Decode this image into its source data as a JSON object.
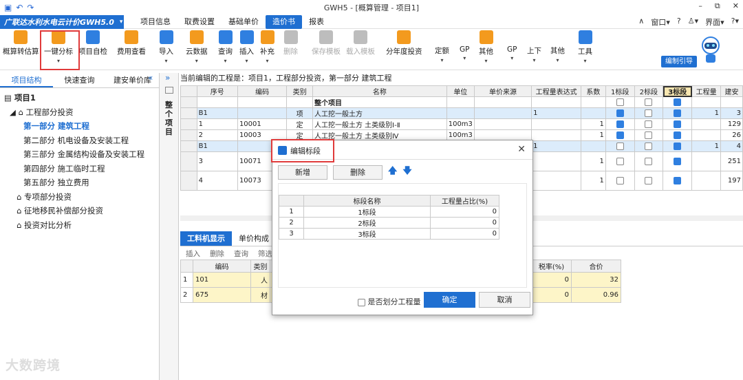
{
  "window": {
    "title": "GWH5 - [概算管理 - 项目1]",
    "controls": [
      "–",
      "⧉",
      "✕"
    ]
  },
  "menubar": {
    "brand": "广联达水利水电云计价GWH5.0",
    "brand_dd": "▾",
    "items": [
      "项目信息",
      "取费设置",
      "基础单价",
      "造价书",
      "报表"
    ],
    "active_index": 3,
    "right": [
      "∧",
      "窗口",
      "▾",
      "?",
      "♙",
      "▾",
      "界面",
      "▾",
      "?",
      "▾"
    ]
  },
  "toolbar": {
    "items": [
      {
        "label": "概算转估算",
        "icon": "convert-icon"
      },
      {
        "label": "一键分标",
        "icon": "split-section-icon",
        "arrow": "▾"
      },
      {
        "label": "项目自检",
        "icon": "check-icon"
      },
      {
        "label": "费用查看",
        "icon": "view-fee-icon"
      },
      {
        "label": "导入",
        "icon": "import-icon",
        "arrow": "▾"
      },
      {
        "label": "云数据",
        "icon": "cloud-icon",
        "arrow": "▾"
      },
      {
        "label": "查询",
        "icon": "query-icon",
        "arrow": "▾"
      },
      {
        "label": "插入",
        "icon": "insert-icon",
        "arrow": "▾"
      },
      {
        "label": "补充",
        "icon": "supplement-icon",
        "arrow": "▾"
      },
      {
        "label": "删除",
        "icon": "delete-icon",
        "disabled": true
      },
      {
        "label": "保存模板",
        "icon": "save-template-icon",
        "disabled": true
      },
      {
        "label": "载入模板",
        "icon": "load-template-icon",
        "disabled": true
      },
      {
        "label": "分年度投资",
        "icon": "annual-icon"
      },
      {
        "label": "定额",
        "icon": "quota-icon",
        "arrow": "▾"
      },
      {
        "label": "GP",
        "icon": "gp-icon",
        "arrow": "▾"
      },
      {
        "label": "其他",
        "icon": "other-icon",
        "arrow": "▾"
      },
      {
        "label": "GP",
        "icon": "gp2-icon",
        "arrow": "▾"
      },
      {
        "label": "上下",
        "icon": "updown-icon",
        "arrow": "▾"
      },
      {
        "label": "其他",
        "icon": "other2-icon",
        "arrow": "▾"
      },
      {
        "label": "工具",
        "icon": "tools-icon",
        "arrow": "▾"
      }
    ],
    "guide": "编制引导"
  },
  "left": {
    "tabs": [
      "项目结构",
      "快速查询",
      "建安单价库"
    ],
    "collapse": "«",
    "tree": [
      {
        "text": "项目1",
        "level": 0
      },
      {
        "text": "工程部分投资",
        "level": 1
      },
      {
        "text": "第一部分  建筑工程",
        "level": 2,
        "selected": true
      },
      {
        "text": "第二部分  机电设备及安装工程",
        "level": 2
      },
      {
        "text": "第三部分  金属结构设备及安装工程",
        "level": 2
      },
      {
        "text": "第四部分  施工临时工程",
        "level": 2
      },
      {
        "text": "第五部分  独立费用",
        "level": 2
      },
      {
        "text": "专项部分投资",
        "level": 1
      },
      {
        "text": "征地移民补偿部分投资",
        "level": 1
      },
      {
        "text": "投资对比分析",
        "level": 1
      }
    ]
  },
  "expand": "»",
  "vstrip": "整个项目",
  "crumb": "当前编辑的工程是：项目1，工程部分投资，第一部分 建筑工程",
  "grid": {
    "headers": [
      "序号",
      "编码",
      "类别",
      "名称",
      "单位",
      "单价来源",
      "工程量表达式",
      "系数",
      "1标段",
      "2标段",
      "3标段",
      "工程量",
      "建安"
    ],
    "rows": [
      {
        "no": "",
        "code": "",
        "type": "",
        "name": "整个项目",
        "unit": "",
        "src": "",
        "expr": "",
        "coef": "",
        "c1": false,
        "c2": false,
        "c3": true,
        "qty": "",
        "amt": "",
        "bold": true
      },
      {
        "no": "B1",
        "code": "",
        "type": "项",
        "name": "人工挖一般土方",
        "unit": "",
        "src": "",
        "expr": "1",
        "coef": "",
        "c1": true,
        "c2": false,
        "c3": true,
        "qty": "1",
        "amt": "3",
        "sel": true
      },
      {
        "no": "1",
        "code": "10001",
        "type": "定",
        "name": "人工挖一般土方 土类级别Ⅰ-Ⅱ",
        "unit": "100m3",
        "src": "",
        "expr": "",
        "coef": "1",
        "c1": true,
        "c2": false,
        "c3": true,
        "qty": "",
        "amt": "129"
      },
      {
        "no": "2",
        "code": "10003",
        "type": "定",
        "name": "人工挖一般土方 土类级别Ⅳ",
        "unit": "100m3",
        "src": "",
        "expr": "",
        "coef": "1",
        "c1": true,
        "c2": false,
        "c3": true,
        "qty": "",
        "amt": "26"
      },
      {
        "no": "B1",
        "code": "",
        "type": "",
        "name": "",
        "unit": "",
        "src": "",
        "expr": "1",
        "coef": "",
        "c1": false,
        "c2": false,
        "c3": true,
        "qty": "1",
        "amt": "4",
        "sel": true
      },
      {
        "no": "3",
        "code": "10071",
        "type": "",
        "name": "",
        "unit": "",
        "src": "",
        "expr": "",
        "coef": "1",
        "c1": false,
        "c2": false,
        "c3": true,
        "qty": "",
        "amt": "251"
      },
      {
        "no": "4",
        "code": "10073",
        "type": "",
        "name": "",
        "unit": "",
        "src": "",
        "expr": "",
        "coef": "1",
        "c1": false,
        "c2": false,
        "c3": true,
        "qty": "",
        "amt": "197"
      }
    ]
  },
  "bottom": {
    "tabs": [
      "工料机显示",
      "单价构成"
    ],
    "tools": [
      "插入",
      "删除",
      "查询",
      "筛选"
    ],
    "headers": [
      "",
      "编码",
      "类别",
      "",
      "税率(%)",
      "合价"
    ],
    "rows": [
      {
        "no": "1",
        "code": "101",
        "type": "人",
        "name": "人",
        "tax": "0",
        "total": "32"
      },
      {
        "no": "2",
        "code": "675",
        "type": "材",
        "name": "零",
        "tax": "0",
        "total": "0.96"
      }
    ]
  },
  "dialog": {
    "title": "编辑标段",
    "close": "✕",
    "add": "新增",
    "delete": "删除",
    "up": "🡅",
    "down": "🡇",
    "headers": [
      "",
      "标段名称",
      "工程量占比(%)"
    ],
    "rows": [
      {
        "no": "1",
        "name": "1标段",
        "pct": "0"
      },
      {
        "no": "2",
        "name": "2标段",
        "pct": "0"
      },
      {
        "no": "3",
        "name": "3标段",
        "pct": "0"
      }
    ],
    "checkbox": "是否划分工程量",
    "ok": "确定",
    "cancel": "取消"
  },
  "watermark": "大数跨境"
}
